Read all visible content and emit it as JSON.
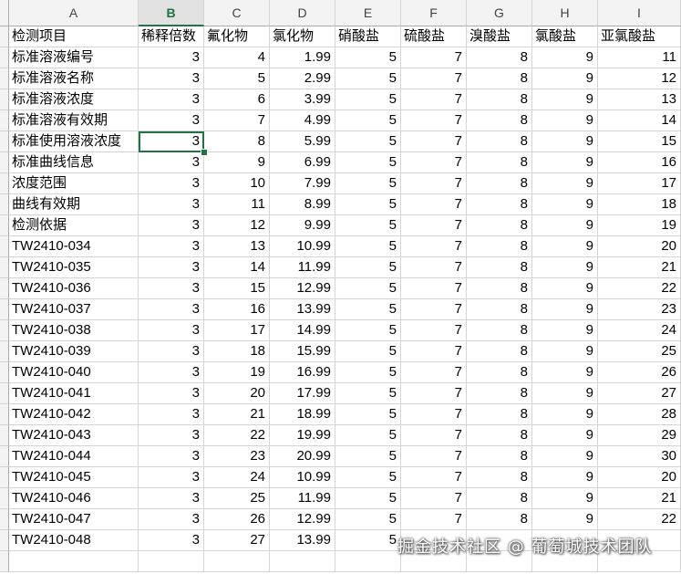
{
  "columns": [
    "A",
    "B",
    "C",
    "D",
    "E",
    "F",
    "G",
    "H",
    "I"
  ],
  "active_column": "B",
  "accent_color": "#217346",
  "header_row": [
    "检测项目",
    "稀释倍数",
    "氟化物",
    "氯化物",
    "硝酸盐",
    "硫酸盐",
    "溴酸盐",
    "氯酸盐",
    "亚氯酸盐"
  ],
  "rows": [
    [
      "标准溶液编号",
      "3",
      "4",
      "1.99",
      "5",
      "7",
      "8",
      "9",
      "11"
    ],
    [
      "标准溶液名称",
      "3",
      "5",
      "2.99",
      "5",
      "7",
      "8",
      "9",
      "12"
    ],
    [
      "标准溶液浓度",
      "3",
      "6",
      "3.99",
      "5",
      "7",
      "8",
      "9",
      "13"
    ],
    [
      "标准溶液有效期",
      "3",
      "7",
      "4.99",
      "5",
      "7",
      "8",
      "9",
      "14"
    ],
    [
      "标准使用溶液浓度",
      "3",
      "8",
      "5.99",
      "5",
      "7",
      "8",
      "9",
      "15"
    ],
    [
      "标准曲线信息",
      "3",
      "9",
      "6.99",
      "5",
      "7",
      "8",
      "9",
      "16"
    ],
    [
      "浓度范围",
      "3",
      "10",
      "7.99",
      "5",
      "7",
      "8",
      "9",
      "17"
    ],
    [
      "曲线有效期",
      "3",
      "11",
      "8.99",
      "5",
      "7",
      "8",
      "9",
      "18"
    ],
    [
      "检测依据",
      "3",
      "12",
      "9.99",
      "5",
      "7",
      "8",
      "9",
      "19"
    ],
    [
      "TW2410-034",
      "3",
      "13",
      "10.99",
      "5",
      "7",
      "8",
      "9",
      "20"
    ],
    [
      "TW2410-035",
      "3",
      "14",
      "11.99",
      "5",
      "7",
      "8",
      "9",
      "21"
    ],
    [
      "TW2410-036",
      "3",
      "15",
      "12.99",
      "5",
      "7",
      "8",
      "9",
      "22"
    ],
    [
      "TW2410-037",
      "3",
      "16",
      "13.99",
      "5",
      "7",
      "8",
      "9",
      "23"
    ],
    [
      "TW2410-038",
      "3",
      "17",
      "14.99",
      "5",
      "7",
      "8",
      "9",
      "24"
    ],
    [
      "TW2410-039",
      "3",
      "18",
      "15.99",
      "5",
      "7",
      "8",
      "9",
      "25"
    ],
    [
      "TW2410-040",
      "3",
      "19",
      "16.99",
      "5",
      "7",
      "8",
      "9",
      "26"
    ],
    [
      "TW2410-041",
      "3",
      "20",
      "17.99",
      "5",
      "7",
      "8",
      "9",
      "27"
    ],
    [
      "TW2410-042",
      "3",
      "21",
      "18.99",
      "5",
      "7",
      "8",
      "9",
      "28"
    ],
    [
      "TW2410-043",
      "3",
      "22",
      "19.99",
      "5",
      "7",
      "8",
      "9",
      "29"
    ],
    [
      "TW2410-044",
      "3",
      "23",
      "20.99",
      "5",
      "7",
      "8",
      "9",
      "30"
    ],
    [
      "TW2410-045",
      "3",
      "24",
      "10.99",
      "5",
      "7",
      "8",
      "9",
      "20"
    ],
    [
      "TW2410-046",
      "3",
      "25",
      "11.99",
      "5",
      "7",
      "8",
      "9",
      "21"
    ],
    [
      "TW2410-047",
      "3",
      "26",
      "12.99",
      "5",
      "7",
      "8",
      "9",
      "22"
    ],
    [
      "TW2410-048",
      "3",
      "27",
      "13.99",
      "5",
      "",
      "",
      "",
      ""
    ]
  ],
  "selected_cell": {
    "row": 4,
    "col": 1
  },
  "watermark": "掘金技术社区 @ 葡萄城技术团队"
}
